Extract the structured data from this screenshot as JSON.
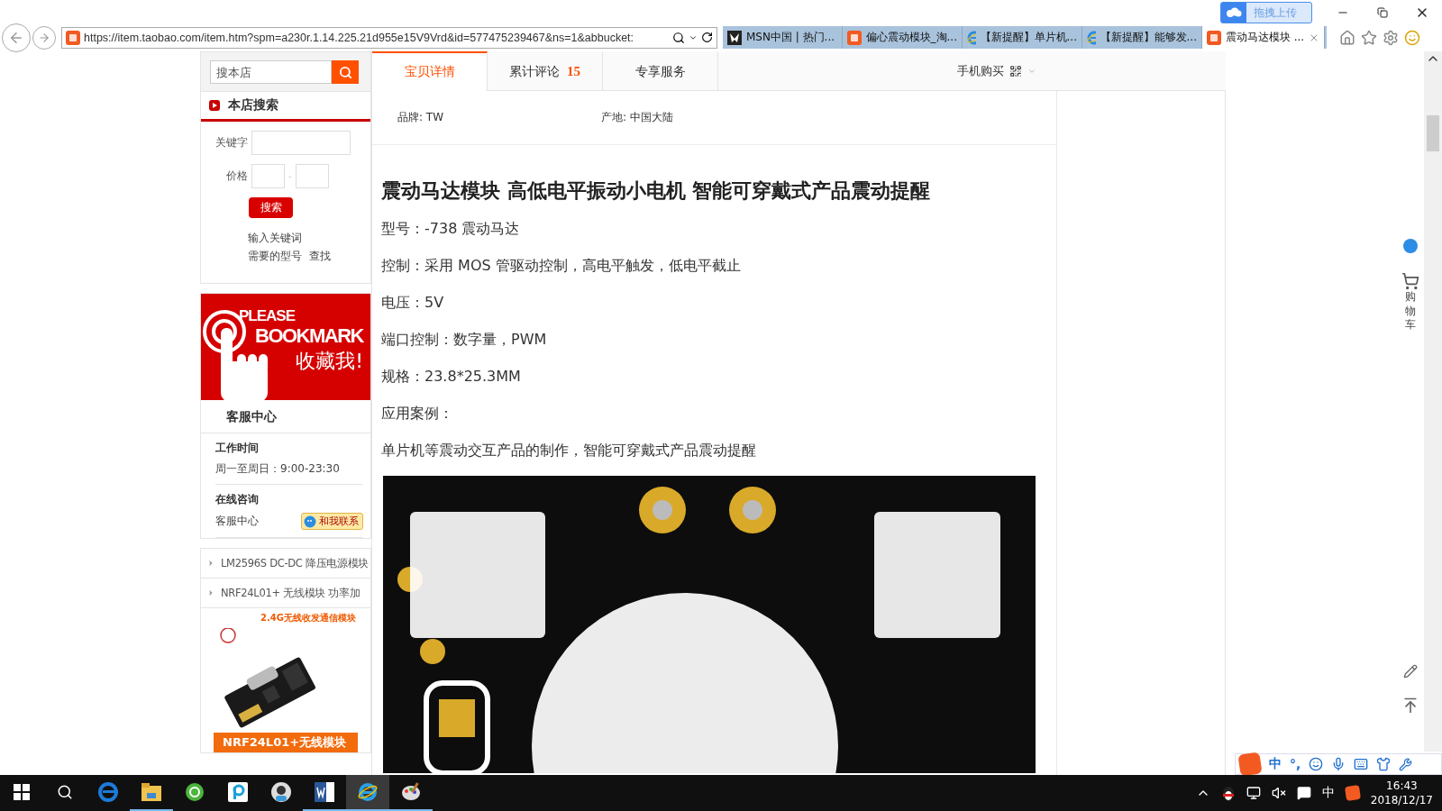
{
  "browser": {
    "address": "https://item.taobao.com/item.htm?spm=a230r.1.14.225.21d955e15V9Vrd&id=577475239467&ns=1&abbucket:",
    "upload_button": "拖拽上传",
    "tabs": [
      {
        "title": "MSN中国 | 热门...",
        "selected": false
      },
      {
        "title": "偏心震动模块_淘...",
        "selected": false
      },
      {
        "title": "【新提醒】单片机...",
        "selected": false
      },
      {
        "title": "【新提醒】能够发...",
        "selected": false
      },
      {
        "title": "震动马达模块 ...",
        "selected": true
      }
    ]
  },
  "sidebar": {
    "shop_search": {
      "placeholder": "搜本店"
    },
    "store_search": {
      "title": "本店搜索",
      "keyword_label": "关键字",
      "price_label": "价格",
      "price_separator": "-",
      "button": "搜索",
      "hint_lines": [
        "输入关键词",
        "需要的型号  查找"
      ]
    },
    "bookmark_banner": {
      "line1": "PLEASE",
      "line2": "BOOKMARK",
      "line3": "收藏我!"
    },
    "customer_service": {
      "title": "客服中心",
      "work_heading": "工作时间",
      "work_hours": "周一至周日：9:00-23:30",
      "consult_heading": "在线咨询",
      "consult_label": "客服中心",
      "contact_button": "和我联系"
    },
    "related": {
      "items": [
        "LM2596S DC-DC 降压电源模块",
        "NRF24L01+ 无线模块 功率加"
      ],
      "ad_headline": "2.4G无线收发通信模块",
      "ad_caption": "NRF24L01+无线模块"
    }
  },
  "detail_tabs": [
    {
      "label": "宝贝详情",
      "selected": true
    },
    {
      "label": "累计评论",
      "count": "15",
      "selected": false
    },
    {
      "label": "专享服务",
      "selected": false
    }
  ],
  "mobile_buy": "手机购买",
  "attributes": [
    "品牌: TW",
    "产地: 中国大陆"
  ],
  "product_title": "震动马达模块 高低电平振动小电机 智能可穿戴式产品震动提醒",
  "description": [
    "型号：-738 震动马达",
    "控制：采用 MOS 管驱动控制，高电平触发，低电平截止",
    "电压：5V",
    "端口控制：数字量，PWM",
    "规格：23.8*25.3MM",
    "应用案例：",
    "单片机等震动交互产品的制作，智能可穿戴式产品震动提醒"
  ],
  "side_tools": {
    "cart_label": "购物车"
  },
  "ime_bar": {
    "mode": "中",
    "punct": "°,"
  },
  "taskbar": {
    "tray_language": "中",
    "time": "16:43",
    "date": "2018/12/17"
  }
}
